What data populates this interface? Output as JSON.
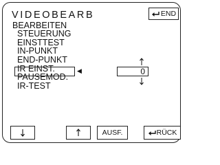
{
  "header": {
    "title": "VIDEOBEARB",
    "end_label": "END",
    "end_icon": "return-icon"
  },
  "subheading": "BEARBEITEN",
  "menu": {
    "items": [
      {
        "label": "STEUERUNG"
      },
      {
        "label": "EINSTTEST"
      },
      {
        "label": "IN-PUNKT"
      },
      {
        "label": "END-PUNKT",
        "selected": true
      },
      {
        "label": "IR EINST."
      },
      {
        "label": "PAUSEMOD."
      },
      {
        "label": "IR-TEST"
      }
    ]
  },
  "selection_marker": "◀",
  "value": {
    "current": "0",
    "up_icon": "up-arrow-indicator",
    "down_icon": "down-arrow-indicator"
  },
  "buttons": {
    "down_icon": "down-arrow-icon",
    "up_icon": "up-arrow-icon",
    "execute_label": "AUSF.",
    "back_label": "RÜCK",
    "back_icon": "return-icon"
  }
}
